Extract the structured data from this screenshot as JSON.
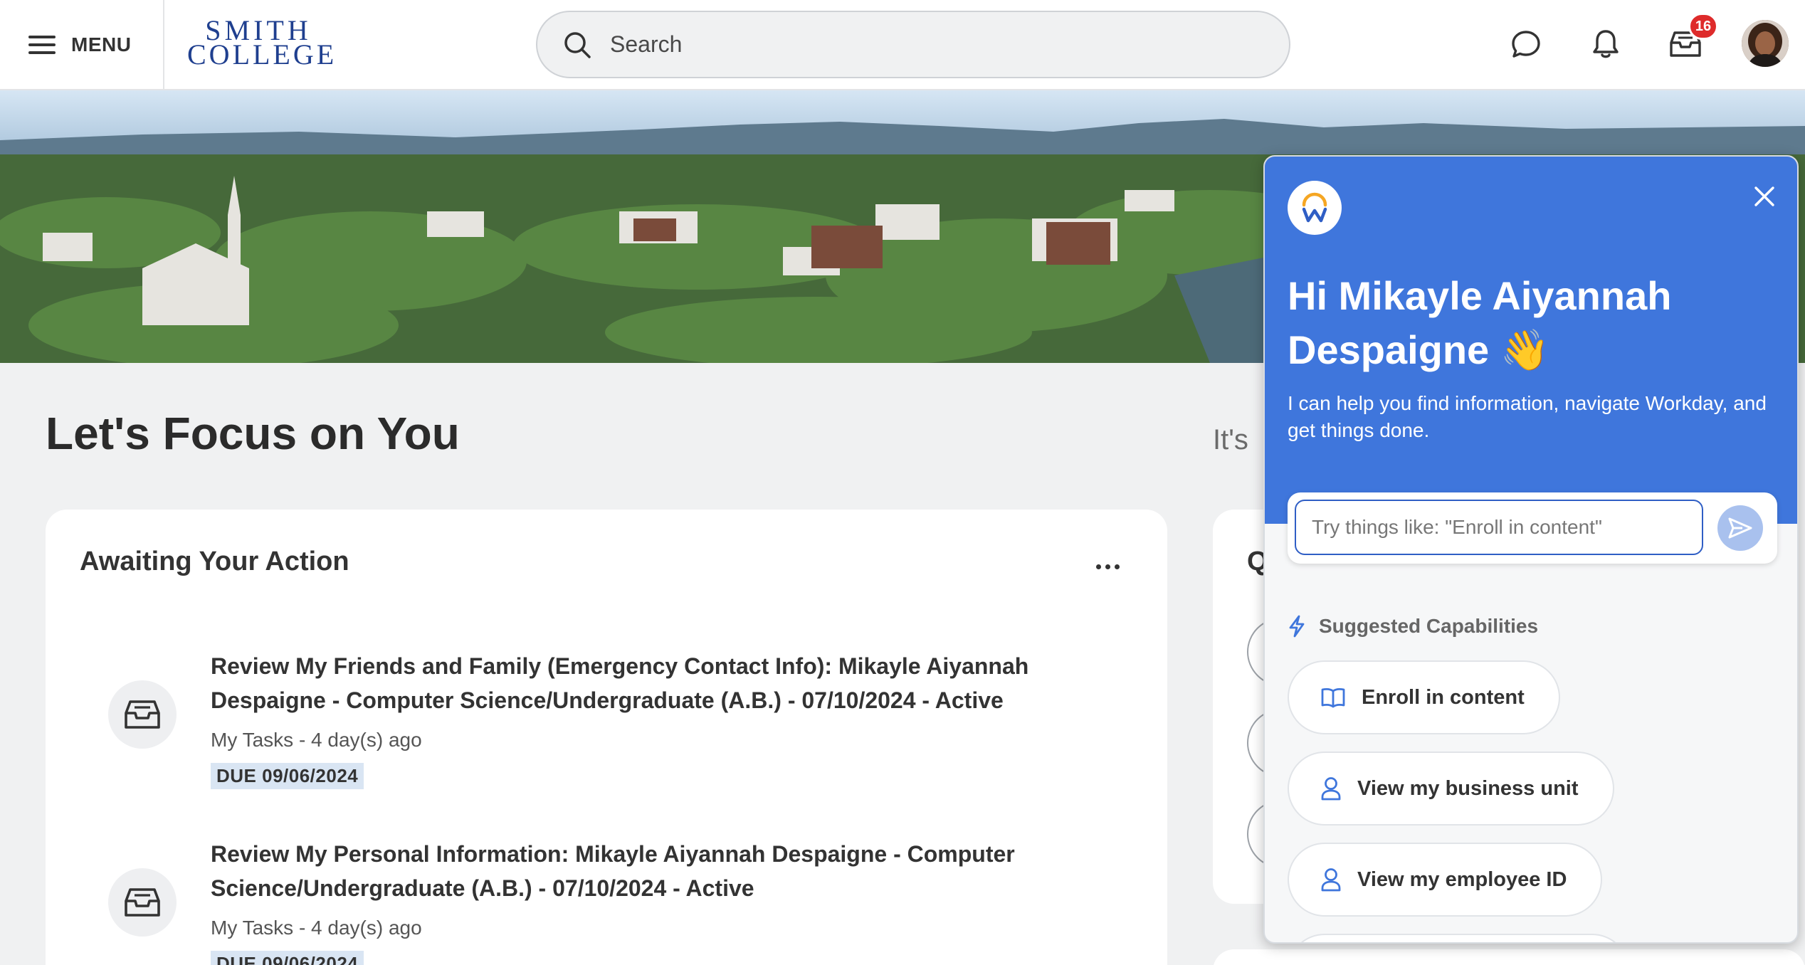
{
  "header": {
    "menu_label": "MENU",
    "logo_line1": "SMITH",
    "logo_line2": "COLLEGE",
    "search_placeholder": "Search",
    "notifications_count": "16"
  },
  "main": {
    "page_title": "Let's Focus on You",
    "side_text": "It's",
    "awaiting_card": {
      "title": "Awaiting Your Action",
      "tasks": [
        {
          "title": "Review My Friends and Family (Emergency Contact Info): Mikayle Aiyannah Despaigne - Computer Science/Undergraduate (A.B.) - 07/10/2024 - Active",
          "meta": "My Tasks - 4 day(s) ago",
          "due": "DUE 09/06/2024"
        },
        {
          "title": "Review My Personal Information: Mikayle Aiyannah Despaigne - Computer Science/Undergraduate (A.B.) - 07/10/2024 - Active",
          "meta": "My Tasks - 4 day(s) ago",
          "due": "DUE 09/06/2024"
        }
      ]
    },
    "quick_card_initial": "Q"
  },
  "assistant": {
    "greeting": "Hi Mikayle Aiyannah Despaigne 👋",
    "intro": "I can help you find information, navigate Workday, and get things done.",
    "input_placeholder": "Try things like: \"Enroll in content\"",
    "suggested_label": "Suggested Capabilities",
    "chips": [
      {
        "label": "Enroll in content",
        "icon": "book-icon"
      },
      {
        "label": "View my business unit",
        "icon": "person-icon"
      },
      {
        "label": "View my employee ID",
        "icon": "person-icon"
      }
    ]
  },
  "colors": {
    "assistant_blue": "#3f76dc",
    "logo_blue": "#1f3f8f",
    "badge_red": "#de2b2b",
    "due_bg": "#d9e5f3"
  }
}
